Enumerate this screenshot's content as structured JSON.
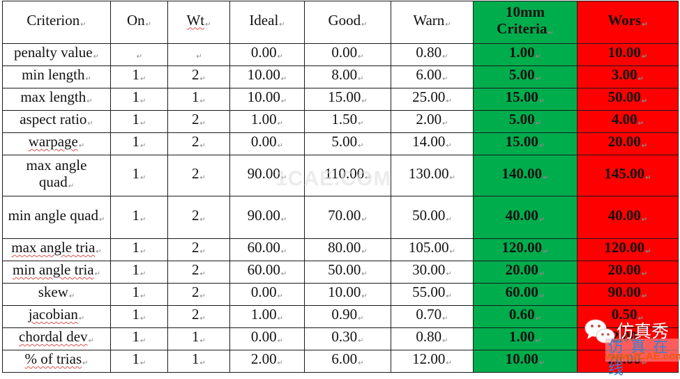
{
  "table": {
    "headers": [
      "Criterion",
      "On",
      "Wt",
      "Ideal",
      "Good",
      "Warn",
      "10mm Criteria",
      "Wors"
    ],
    "rows": [
      {
        "criterion": "penalty value",
        "on": "",
        "wt": "",
        "ideal": "0.00",
        "good": "0.00",
        "warn": "0.80",
        "criteria10mm": "1.00",
        "wors": "10.00"
      },
      {
        "criterion": "min length",
        "on": "1",
        "wt": "2",
        "ideal": "10.00",
        "good": "8.00",
        "warn": "6.00",
        "criteria10mm": "5.00",
        "wors": "3.00"
      },
      {
        "criterion": "max length",
        "on": "1",
        "wt": "1",
        "ideal": "10.00",
        "good": "15.00",
        "warn": "25.00",
        "criteria10mm": "15.00",
        "wors": "50.00"
      },
      {
        "criterion": "aspect ratio",
        "on": "1",
        "wt": "2",
        "ideal": "1.00",
        "good": "1.50",
        "warn": "2.00",
        "criteria10mm": "5.00",
        "wors": "4.00"
      },
      {
        "criterion": "warpage",
        "on": "1",
        "wt": "2",
        "ideal": "0.00",
        "good": "5.00",
        "warn": "14.00",
        "criteria10mm": "15.00",
        "wors": "20.00"
      },
      {
        "criterion": "max angle quad",
        "on": "1",
        "wt": "2",
        "ideal": "90.00",
        "good": "110.00",
        "warn": "130.00",
        "criteria10mm": "140.00",
        "wors": "145.00"
      },
      {
        "criterion": "min angle quad",
        "on": "1",
        "wt": "2",
        "ideal": "90.00",
        "good": "70.00",
        "warn": "50.00",
        "criteria10mm": "40.00",
        "wors": "40.00"
      },
      {
        "criterion": "max angle tria",
        "on": "1",
        "wt": "2",
        "ideal": "60.00",
        "good": "80.00",
        "warn": "105.00",
        "criteria10mm": "120.00",
        "wors": "120.00"
      },
      {
        "criterion": "min angle tria",
        "on": "1",
        "wt": "2",
        "ideal": "60.00",
        "good": "50.00",
        "warn": "30.00",
        "criteria10mm": "20.00",
        "wors": "20.00"
      },
      {
        "criterion": "skew",
        "on": "1",
        "wt": "2",
        "ideal": "0.00",
        "good": "10.00",
        "warn": "55.00",
        "criteria10mm": "60.00",
        "wors": "90.00"
      },
      {
        "criterion": "jacobian",
        "on": "1",
        "wt": "2",
        "ideal": "1.00",
        "good": "0.90",
        "warn": "0.70",
        "criteria10mm": "0.60",
        "wors": "0.50"
      },
      {
        "criterion": "chordal dev",
        "on": "1",
        "wt": "1",
        "ideal": "0.00",
        "good": "0.30",
        "warn": "0.80",
        "criteria10mm": "1.00",
        "wors": "2.00"
      },
      {
        "criterion": "% of trias",
        "on": "1",
        "wt": "1",
        "ideal": "2.00",
        "good": "6.00",
        "warn": "12.00",
        "criteria10mm": "10.00",
        "wors": "20.00"
      }
    ]
  },
  "colors": {
    "criteria_column": "#00ad4c",
    "wors_column": "#ff0000"
  },
  "watermark": {
    "center_text": "1CAE.COM",
    "badge_title": "仿真秀",
    "badge_site_cn": "仿真在线",
    "badge_site_url": "www.1CAE.com"
  }
}
